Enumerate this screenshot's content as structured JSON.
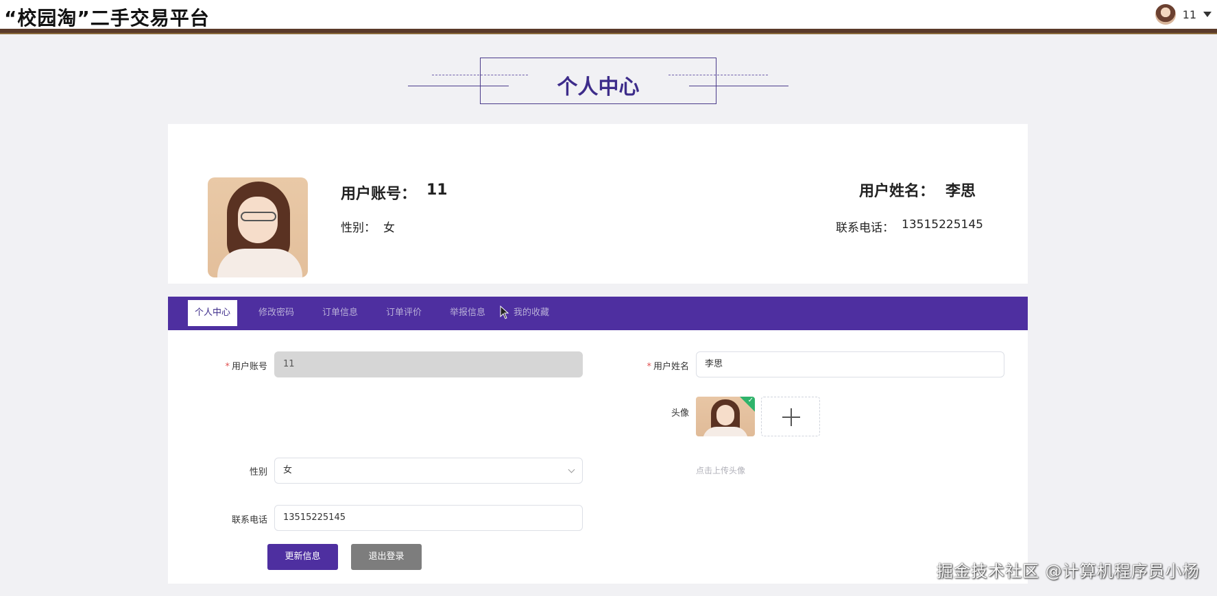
{
  "header": {
    "site_title": "“校园淘”二手交易平台",
    "user_name": "11"
  },
  "page_heading": "个人中心",
  "profile": {
    "account_label": "用户账号：",
    "account_value": "11",
    "gender_label": "性别：",
    "gender_value": "女",
    "name_label": "用户姓名：",
    "name_value": "李思",
    "phone_label": "联系电话：",
    "phone_value": "13515225145"
  },
  "tabs": [
    {
      "label": "个人中心",
      "active": true
    },
    {
      "label": "修改密码",
      "active": false
    },
    {
      "label": "订单信息",
      "active": false
    },
    {
      "label": "订单评价",
      "active": false
    },
    {
      "label": "举报信息",
      "active": false
    },
    {
      "label": "我的收藏",
      "active": false
    }
  ],
  "form": {
    "account_label": "用户账号",
    "account_value": "11",
    "name_label": "用户姓名",
    "name_value": "李思",
    "avatar_label": "头像",
    "upload_hint": "点击上传头像",
    "gender_label": "性别",
    "gender_value": "女",
    "phone_label": "联系电话",
    "phone_value": "13515225145"
  },
  "buttons": {
    "update": "更新信息",
    "logout": "退出登录"
  },
  "watermark": "掘金技术社区 @计算机程序员小杨",
  "colors": {
    "accent": "#4e2fa0",
    "heading": "#3d2c8a",
    "logout_button": "#7d7d7d",
    "disabled_input": "#d6d6d6"
  },
  "icons": {
    "user_menu": "chevron-down-icon",
    "upload_add": "plus-icon",
    "upload_success": "check-icon"
  }
}
